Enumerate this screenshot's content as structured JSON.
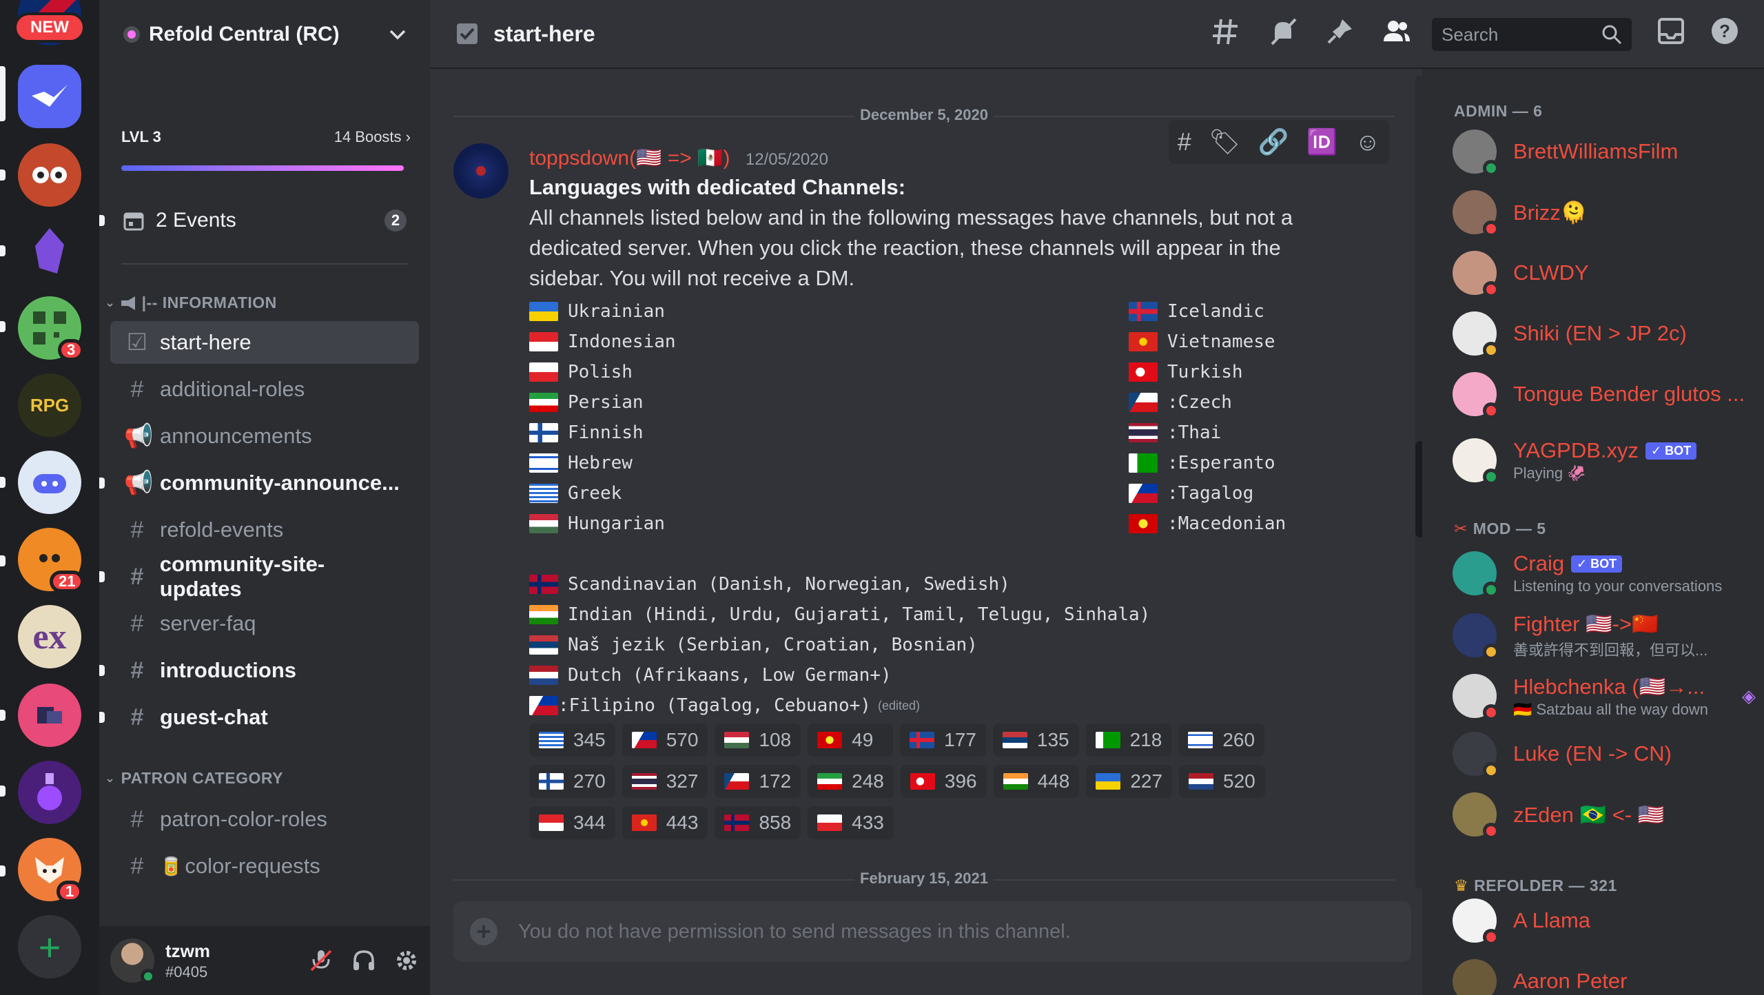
{
  "servers": {
    "new_badge": "NEW",
    "mentions": [
      "3",
      "21",
      "1"
    ]
  },
  "guild": {
    "name": "Refold Central (RC)",
    "level": "LVL 3",
    "boosts": "14 Boosts"
  },
  "events": {
    "label": "2 Events",
    "count": "2"
  },
  "categories": {
    "info": "|-- INFORMATION",
    "patron": "PATRON CATEGORY"
  },
  "channels": [
    {
      "name": "start-here"
    },
    {
      "name": "additional-roles"
    },
    {
      "name": "announcements"
    },
    {
      "name": "community-announce..."
    },
    {
      "name": "refold-events"
    },
    {
      "name": "community-site-updates"
    },
    {
      "name": "server-faq"
    },
    {
      "name": "introductions"
    },
    {
      "name": "guest-chat"
    },
    {
      "name": "patron-color-roles"
    },
    {
      "name": "color-requests"
    }
  ],
  "user": {
    "name": "tzwm",
    "tag": "#0405"
  },
  "topbar": {
    "channel": "start-here",
    "search_placeholder": "Search"
  },
  "messages": {
    "date1": "December 5, 2020",
    "date2": "February 15, 2021",
    "author": "toppsdown(🇺🇸 => 🇲🇽)",
    "timestamp": "12/05/2020",
    "heading": "Languages with dedicated Channels:",
    "body": "All channels listed below and in the following messages have channels, but not a dedicated server. When you click the reaction, these channels will appear in the sidebar. You will not receive a DM.",
    "languages_left": [
      "Ukrainian",
      "Indonesian",
      "Polish",
      "Persian",
      "Finnish",
      "Hebrew",
      "Greek",
      "Hungarian"
    ],
    "languages_right": [
      "Icelandic",
      "Vietnamese",
      "Turkish",
      ":Czech",
      ":Thai",
      ":Esperanto",
      ":Tagalog",
      ":Macedonian"
    ],
    "multi": [
      "Scandinavian (Danish, Norwegian, Swedish)",
      "Indian (Hindi, Urdu, Gujarati, Tamil, Telugu, Sinhala)",
      "Naš jezik (Serbian, Croatian, Bosnian)",
      "Dutch (Afrikaans, Low German+)",
      ":Filipino (Tagalog, Cebuano+)"
    ],
    "edited": "(edited)",
    "reactions": [
      "345",
      "570",
      "108",
      "49",
      "177",
      "135",
      "218",
      "260",
      "270",
      "327",
      "172",
      "248",
      "396",
      "448",
      "227",
      "520",
      "344",
      "443",
      "858",
      "433"
    ],
    "composer_placeholder": "You do not have permission to send messages in this channel."
  },
  "members": {
    "admin_header": "ADMIN — 6",
    "mod_header": "MOD — 5",
    "refolder_header": "REFOLDER — 321",
    "admins": [
      {
        "name": "BrettWilliamsFilm"
      },
      {
        "name": "Brizz🫠"
      },
      {
        "name": "CLWDY"
      },
      {
        "name": "Shiki (EN > JP 2c)"
      },
      {
        "name": "Tongue Bender glutos ..."
      },
      {
        "name": "YAGPDB.xyz",
        "sub": "Playing 🦑"
      }
    ],
    "mods": [
      {
        "name": "Craig",
        "sub": "Listening to your conversations"
      },
      {
        "name": "Fighter 🇺🇸->🇨🇳",
        "sub": "善或許得不到回報，但可以..."
      },
      {
        "name": "Hlebchenka (🇺🇸→...",
        "sub": "🇩🇪 Satzbau all the way down"
      },
      {
        "name": "Luke (EN -> CN)"
      },
      {
        "name": "zEden 🇧🇷 <- 🇺🇸"
      }
    ],
    "refolders": [
      {
        "name": "A Llama"
      },
      {
        "name": "Aaron Peter"
      }
    ],
    "bot_tag": "✓ BOT"
  }
}
